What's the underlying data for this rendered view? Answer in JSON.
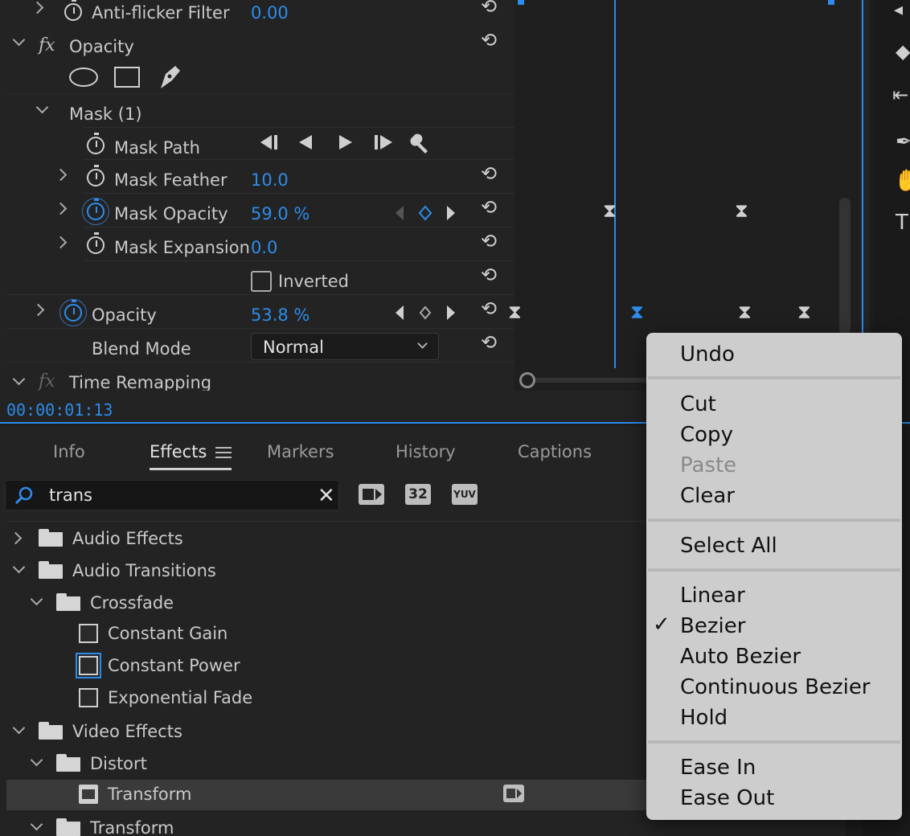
{
  "effect_controls": {
    "rows": {
      "anti_flicker": {
        "label": "Anti-flicker Filter",
        "value": "0.00"
      },
      "opacity_section": {
        "fx": "fx",
        "label": "Opacity"
      },
      "mask": {
        "label": "Mask (1)"
      },
      "mask_path": {
        "label": "Mask Path"
      },
      "mask_feather": {
        "label": "Mask Feather",
        "value": "10.0"
      },
      "mask_opacity": {
        "label": "Mask Opacity",
        "value": "59.0 %"
      },
      "mask_expansion": {
        "label": "Mask Expansion",
        "value": "0.0"
      },
      "inverted": {
        "label": "Inverted",
        "checked": false
      },
      "opacity": {
        "label": "Opacity",
        "value": "53.8 %"
      },
      "blend_mode": {
        "label": "Blend Mode",
        "value": "Normal"
      },
      "time_remapping": {
        "fx": "fx",
        "label": "Time Remapping"
      }
    },
    "timecode": "00:00:01:13"
  },
  "effects_panel": {
    "tabs": [
      {
        "label": "Info",
        "active": false
      },
      {
        "label": "Effects",
        "active": true
      },
      {
        "label": "Markers",
        "active": false
      },
      {
        "label": "History",
        "active": false
      },
      {
        "label": "Captions",
        "active": false
      }
    ],
    "search": {
      "value": "trans"
    },
    "filter_icons": [
      "accelerated-effects-icon",
      "32-bit-icon",
      "yuv-icon"
    ],
    "filter_labels": {
      "bit32": "32",
      "yuv": "YUV"
    },
    "tree": [
      {
        "label": "Audio Effects",
        "type": "folder",
        "expanded": false
      },
      {
        "label": "Audio Transitions",
        "type": "folder",
        "expanded": true
      },
      {
        "label": "Crossfade",
        "type": "folder",
        "expanded": true
      },
      {
        "label": "Constant Gain",
        "type": "effect"
      },
      {
        "label": "Constant Power",
        "type": "effect",
        "selected": true
      },
      {
        "label": "Exponential Fade",
        "type": "effect"
      },
      {
        "label": "Video Effects",
        "type": "folder",
        "expanded": true
      },
      {
        "label": "Distort",
        "type": "folder",
        "expanded": true
      },
      {
        "label": "Transform",
        "type": "effect",
        "highlighted": true
      },
      {
        "label": "Transform",
        "type": "folder",
        "expanded": true
      }
    ]
  },
  "context_menu": {
    "items": [
      {
        "label": "Undo",
        "enabled": true
      },
      {
        "label": "Cut",
        "enabled": true
      },
      {
        "label": "Copy",
        "enabled": true
      },
      {
        "label": "Paste",
        "enabled": false
      },
      {
        "label": "Clear",
        "enabled": true
      },
      {
        "label": "Select All",
        "enabled": true
      },
      {
        "label": "Linear",
        "enabled": true
      },
      {
        "label": "Bezier",
        "enabled": true,
        "checked": true
      },
      {
        "label": "Auto Bezier",
        "enabled": true
      },
      {
        "label": "Continuous Bezier",
        "enabled": true
      },
      {
        "label": "Hold",
        "enabled": true
      },
      {
        "label": "Ease In",
        "enabled": true
      },
      {
        "label": "Ease Out",
        "enabled": true
      }
    ],
    "check_mark": "✓"
  },
  "colors": {
    "accent": "#2d8ceb",
    "panel_bg": "#232323",
    "menu_bg": "#cdcdcd"
  }
}
